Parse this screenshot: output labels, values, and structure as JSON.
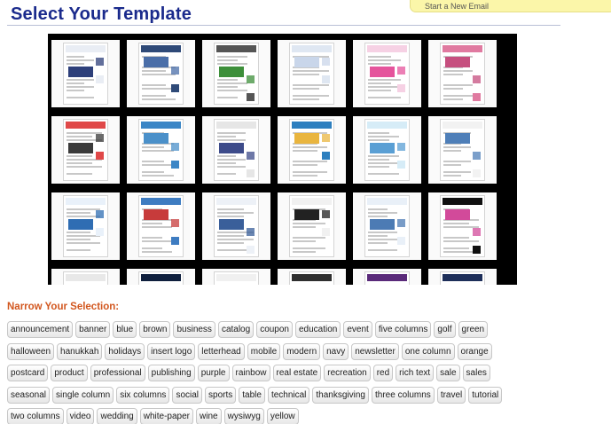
{
  "header": {
    "title": "Select Your Template",
    "new_email_label": "Start a New Email"
  },
  "gallery": {
    "thumbnails": [
      {
        "header_color": "#e9edf4",
        "accent": "#2d3f7a"
      },
      {
        "header_color": "#2f4a78",
        "accent": "#4a6ea8"
      },
      {
        "header_color": "#555555",
        "accent": "#3d8f3a"
      },
      {
        "header_color": "#dfe7f2",
        "accent": "#c9d6ea"
      },
      {
        "header_color": "#f6d1e4",
        "accent": "#e5549c"
      },
      {
        "header_color": "#e07aa0",
        "accent": "#c64f7f"
      },
      {
        "header_color": "#e04848",
        "accent": "#3a3a3a"
      },
      {
        "header_color": "#3b86c6",
        "accent": "#4b90c9"
      },
      {
        "header_color": "#e6e6e6",
        "accent": "#3d4b8a"
      },
      {
        "header_color": "#2d7fbf",
        "accent": "#e9b53f"
      },
      {
        "header_color": "#d6ecf7",
        "accent": "#5a9fd4"
      },
      {
        "header_color": "#f2f2f2",
        "accent": "#4f7fb8"
      },
      {
        "header_color": "#e9f1fa",
        "accent": "#2f6db3"
      },
      {
        "header_color": "#3e7cc1",
        "accent": "#c73b3b"
      },
      {
        "header_color": "#edf1f7",
        "accent": "#3a5f9a"
      },
      {
        "header_color": "#f1f1f1",
        "accent": "#222222"
      },
      {
        "header_color": "#e9f0f8",
        "accent": "#4c7bb4"
      },
      {
        "header_color": "#101010",
        "accent": "#d24a9a"
      },
      {
        "header_color": "#e8e8e8",
        "accent": "#3a4a7a"
      },
      {
        "header_color": "#0f1f3d",
        "accent": "#2c6db5"
      },
      {
        "header_color": "#f0f0f0",
        "accent": "#2e5d9f"
      },
      {
        "header_color": "#2f2f2f",
        "accent": "#d44a2a"
      },
      {
        "header_color": "#5a2a7a",
        "accent": "#c94fc4"
      },
      {
        "header_color": "#1e2f5a",
        "accent": "#6a3fa0"
      }
    ]
  },
  "filters": {
    "heading": "Narrow Your Selection:",
    "rows": [
      [
        "announcement",
        "banner",
        "blue",
        "brown",
        "business",
        "catalog",
        "coupon",
        "education",
        "event",
        "five columns",
        "golf",
        "green"
      ],
      [
        "halloween",
        "hanukkah",
        "holidays",
        "insert logo",
        "letterhead",
        "mobile",
        "modern",
        "navy",
        "newsletter",
        "one column",
        "orange"
      ],
      [
        "postcard",
        "product",
        "professional",
        "publishing",
        "purple",
        "rainbow",
        "real estate",
        "recreation",
        "red",
        "rich text",
        "sale",
        "sales"
      ],
      [
        "seasonal",
        "single column",
        "six columns",
        "social",
        "sports",
        "table",
        "technical",
        "thanksgiving",
        "three columns",
        "travel",
        "tutorial"
      ],
      [
        "two columns",
        "video",
        "wedding",
        "white-paper",
        "wine",
        "wysiwyg",
        "yellow"
      ]
    ]
  }
}
